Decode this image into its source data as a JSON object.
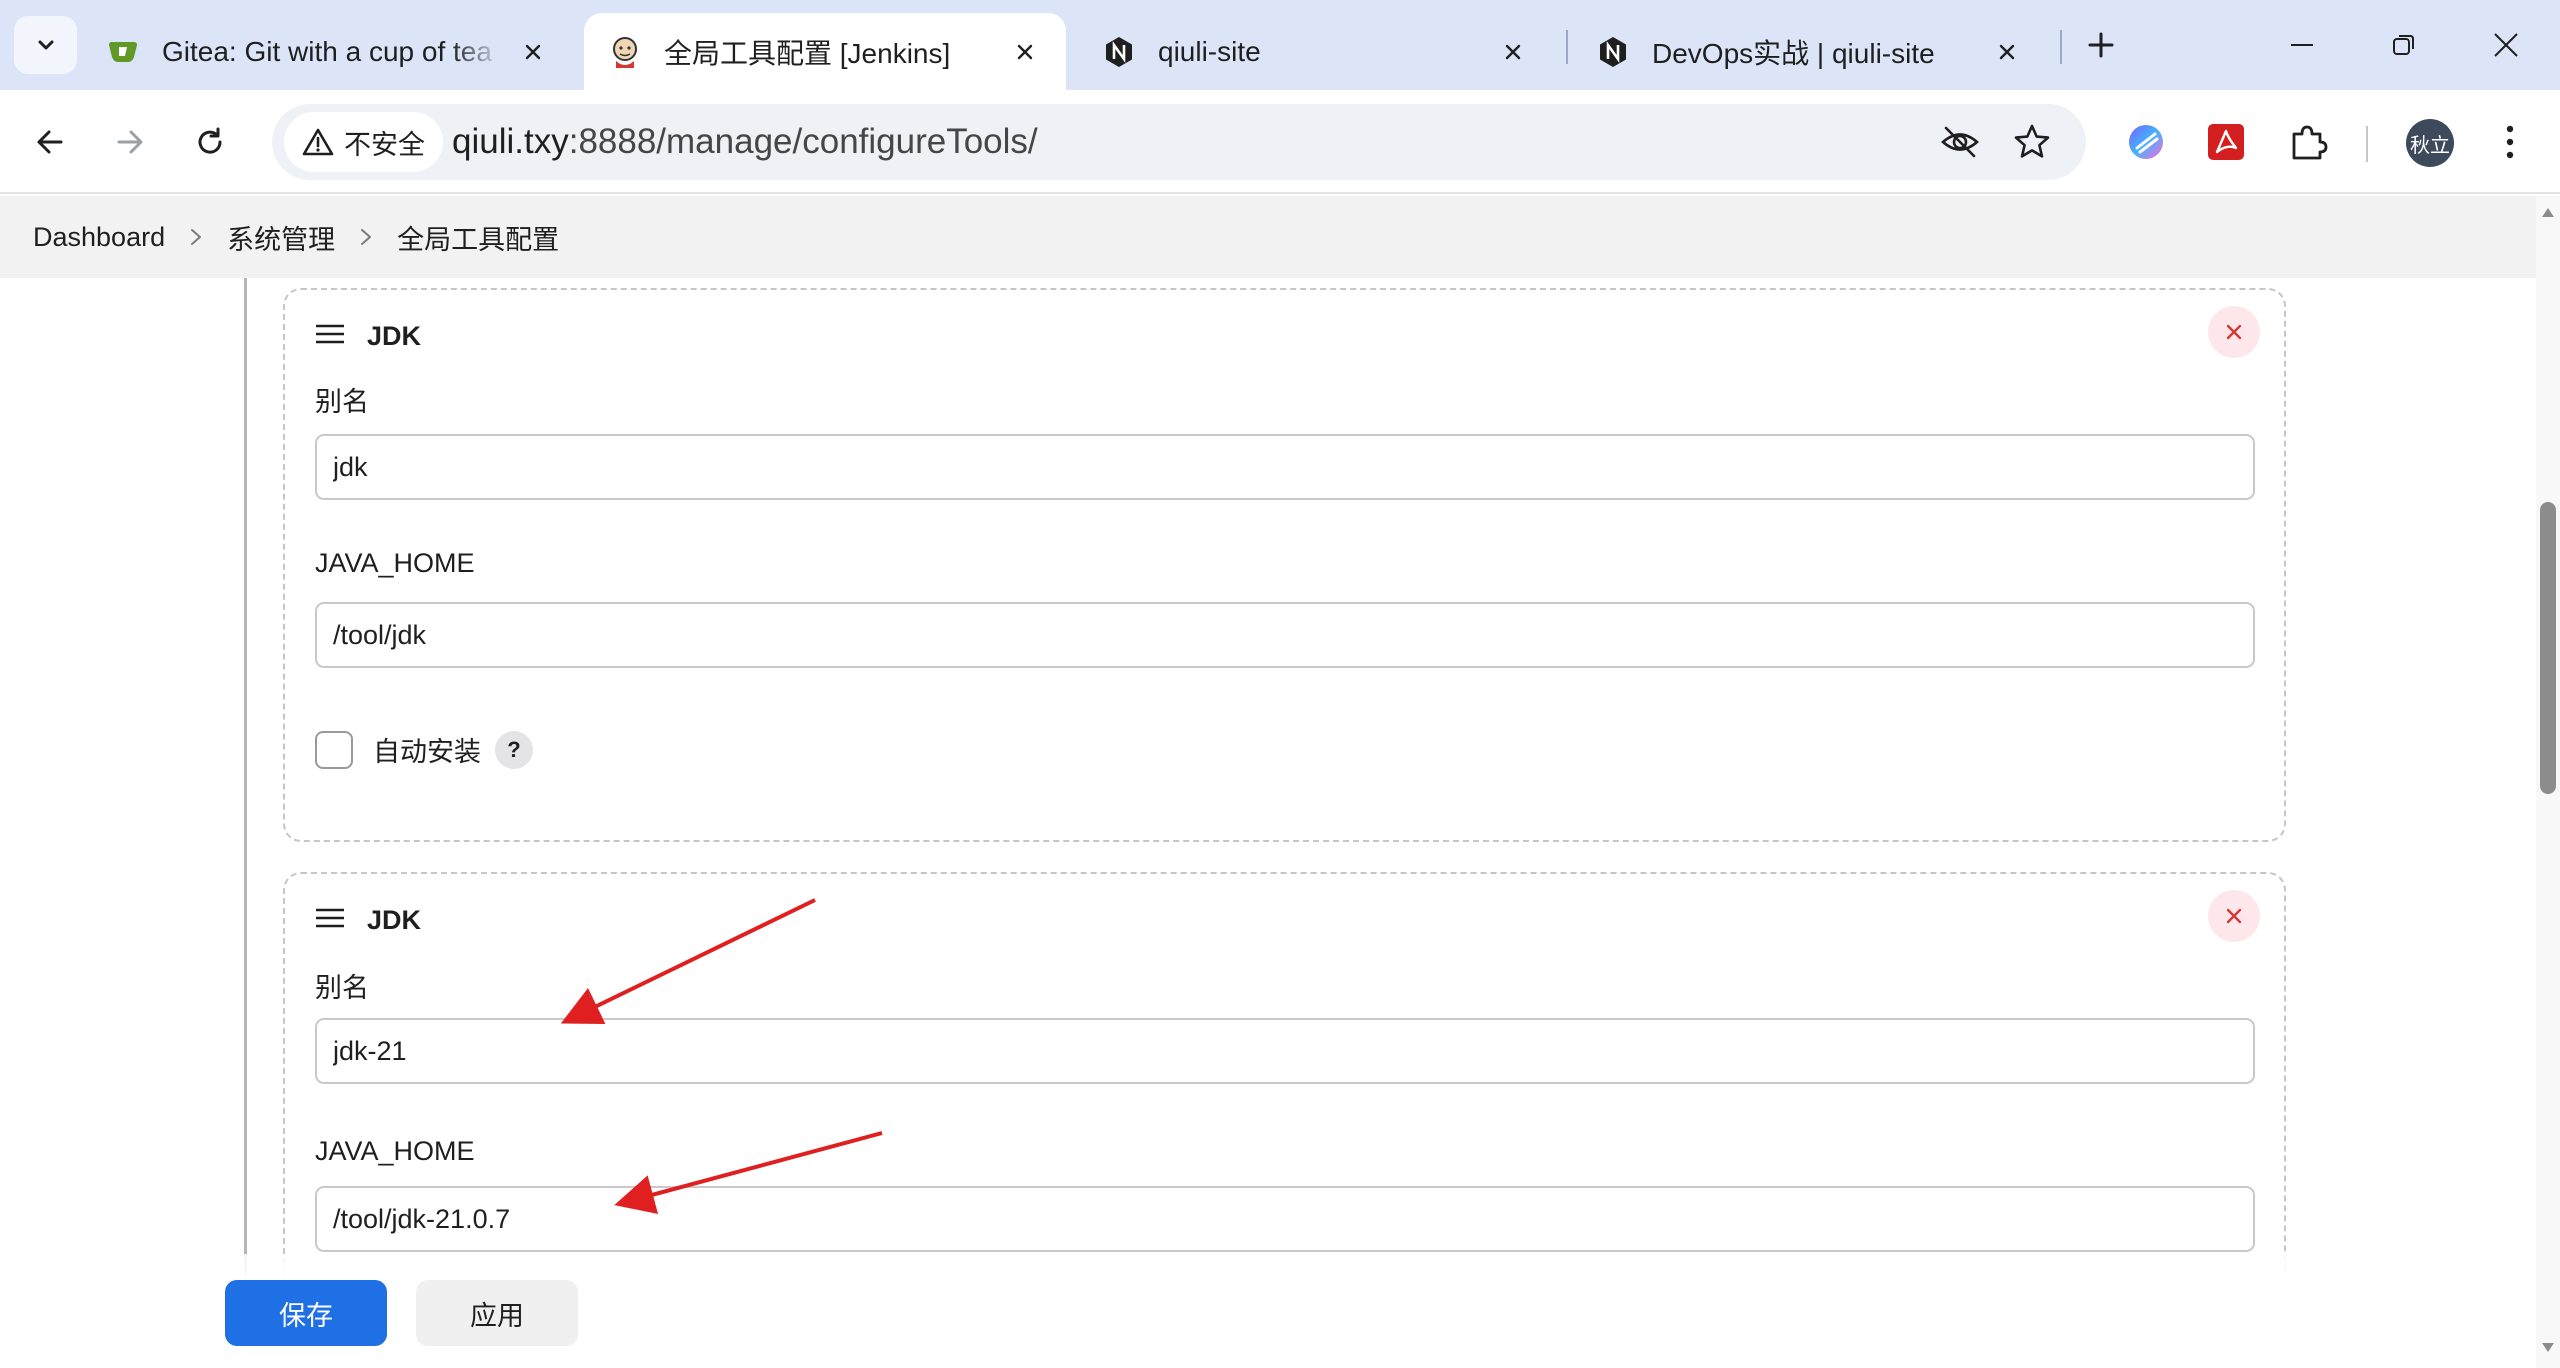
{
  "browser": {
    "tabs": [
      {
        "title": "Gitea: Git with a cup of tea",
        "favicon": "gitea-icon"
      },
      {
        "title": "全局工具配置 [Jenkins]",
        "favicon": "jenkins-icon",
        "active": true
      },
      {
        "title": "qiuli-site",
        "favicon": "nginx-n-icon"
      },
      {
        "title": "DevOps实战 | qiuli-site",
        "favicon": "nginx-n-icon"
      }
    ],
    "security_label": "不安全",
    "url_host": "qiuli.txy",
    "url_path": ":8888/manage/configureTools/",
    "profile_initials": "秋立"
  },
  "breadcrumb": [
    "Dashboard",
    "系统管理",
    "全局工具配置"
  ],
  "jdk_cards": [
    {
      "title": "JDK",
      "alias_label": "别名",
      "alias_value": "jdk",
      "home_label": "JAVA_HOME",
      "home_value": "/tool/jdk",
      "auto_install_label": "自动安装",
      "help_label": "?"
    },
    {
      "title": "JDK",
      "alias_label": "别名",
      "alias_value": "jdk-21",
      "home_label": "JAVA_HOME",
      "home_value": "/tool/jdk-21.0.7"
    }
  ],
  "actions": {
    "save": "保存",
    "apply": "应用"
  },
  "colors": {
    "annotation_arrow": "#e02020",
    "primary_button": "#1f6fe5",
    "delete_bg": "#fde7ea",
    "delete_x": "#d33a3a"
  }
}
